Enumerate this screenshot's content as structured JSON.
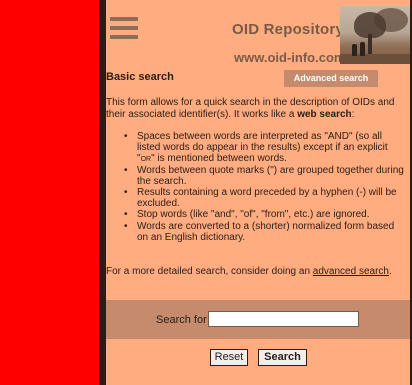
{
  "header": {
    "site_title": "OID Repository",
    "site_url": "www.oid-info.com",
    "menu_icon": "hamburger-menu-icon"
  },
  "tabs": {
    "basic_label": "Basic search",
    "advanced_label": "Advanced search"
  },
  "intro": {
    "text_before": "This form allows for a quick search in the description of OIDs and their associated identifier(s). It works like a ",
    "bold_text": "web search",
    "text_after": ":"
  },
  "rules": {
    "item1_before": "Spaces between words are interpreted as \"AND\" (so all listed words do appear in the results) except if an explicit \"",
    "item1_or": "or",
    "item1_after": "\" is mentioned between words.",
    "item2": "Words between quote marks (\") are grouped together during the search.",
    "item3": "Results containing a word preceded by a hyphen (-) will be excluded.",
    "item4": "Stop words (like \"and\", \"of\", \"from\", etc.) are ignored.",
    "item5": "Words are converted to a (shorter) normalized form based on an English dictionary."
  },
  "footer_note": {
    "text": "For a more detailed search, consider doing an ",
    "link": "advanced search",
    "suffix": "."
  },
  "search": {
    "label": "Search for",
    "value": "",
    "placeholder": ""
  },
  "buttons": {
    "reset": "Reset",
    "search": "Search"
  },
  "colors": {
    "left_panel": "#ff0000",
    "content_bg": "#ffac80",
    "band_bg": "#c48b6c",
    "dark": "#2a1d17"
  }
}
